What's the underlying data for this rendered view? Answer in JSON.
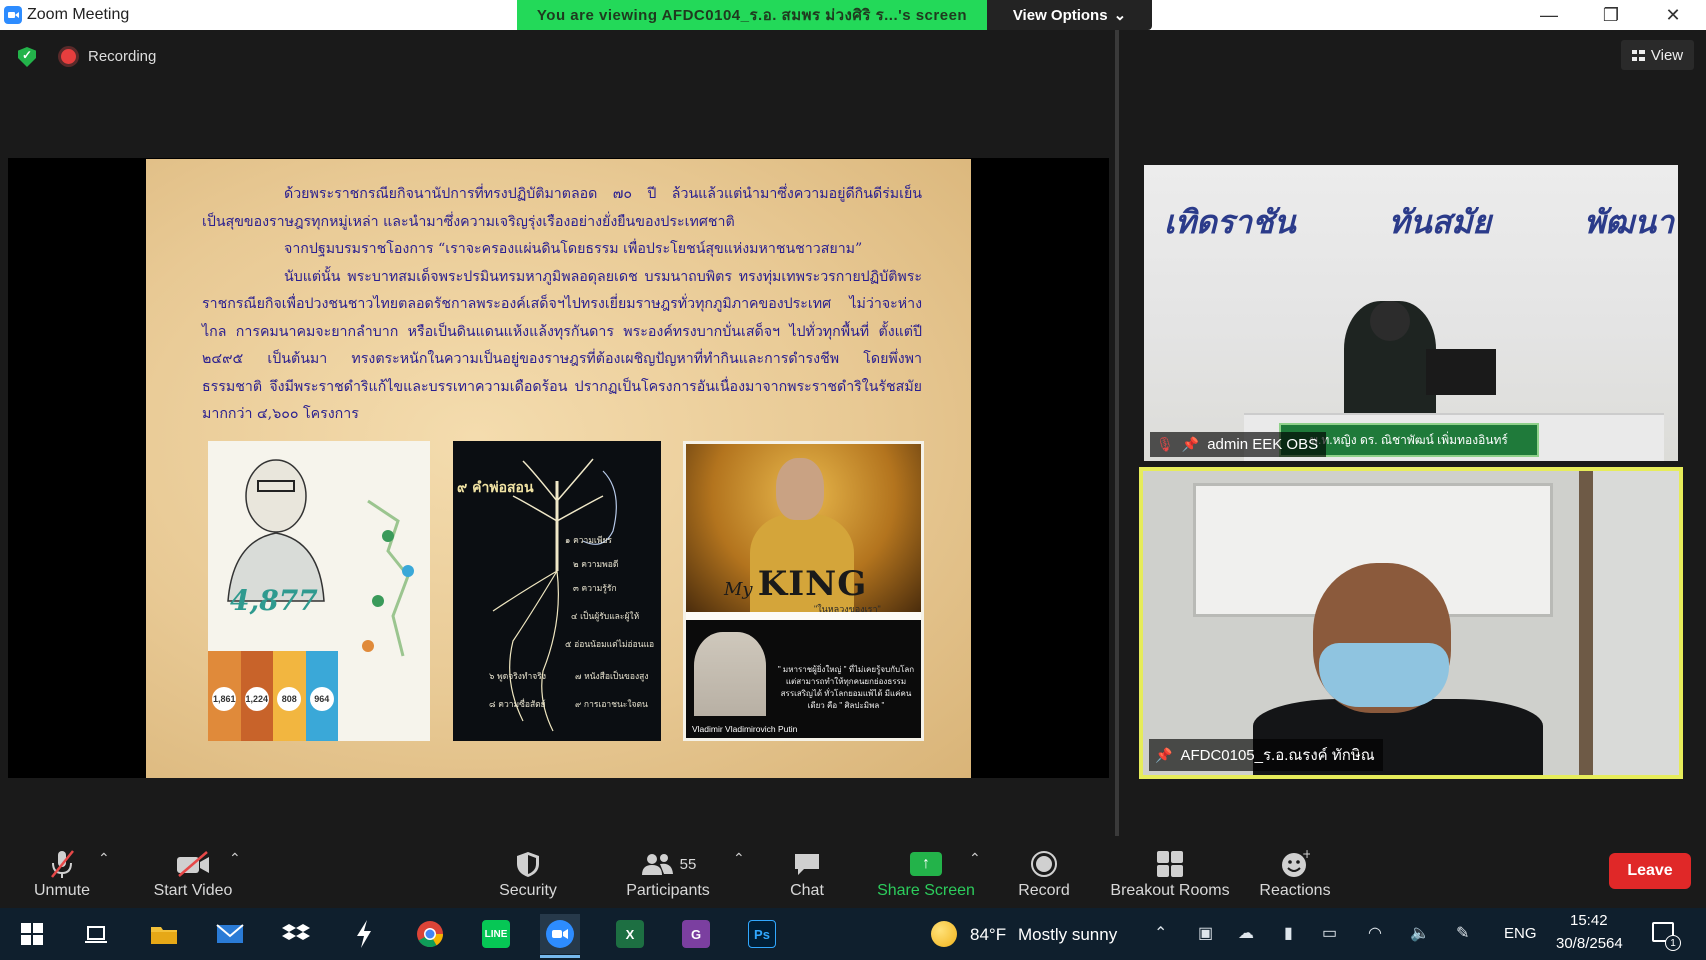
{
  "window": {
    "title": "Zoom Meeting",
    "share_banner": "You  are  viewing  AFDC0104_ร.อ. สมพร  ม่วงศิริ  ร...'s screen",
    "view_options": "View Options",
    "view_options_caret": "⌄",
    "minimize": "—",
    "restore": "❐",
    "close": "✕"
  },
  "meeting": {
    "recording_label": "Recording",
    "view_label": "View"
  },
  "slide": {
    "paragraphs": [
      "ด้วยพระราชกรณียกิจนานัปการที่ทรงปฏิบัติมาตลอด ๗๐ ปี ล้วนแล้วแต่นำมาซึ่งความอยู่ดีกินดีร่มเย็นเป็นสุขของราษฎรทุกหมู่เหล่า และนำมาซึ่งความเจริญรุ่งเรืองอย่างยั่งยืนของประเทศชาติ",
      "จากปฐมบรมราชโองการ “เราจะครองแผ่นดินโดยธรรม เพื่อประโยชน์สุขแห่งมหาชนชาวสยาม”",
      "นับแต่นั้น พระบาทสมเด็จพระปรมินทรมหาภูมิพลอดุลยเดช บรมนาถบพิตร ทรงทุ่มเทพระวรกายปฏิบัติพระราชกรณียกิจเพื่อปวงชนชาวไทยตลอดรัชกาลพระองค์เสด็จฯไปทรงเยี่ยมราษฎรทั่วทุกภูมิภาคของประเทศ ไม่ว่าจะห่างไกล การคมนาคมจะยากลำบาก หรือเป็นดินแดนแห้งแล้งทุรกันดาร พระองค์ทรงบากบั่นเสด็จฯ ไปทั่วทุกพื้นที่ ตั้งแต่ปี ๒๔๙๕ เป็นต้นมา ทรงตระหนักในความเป็นอยู่ของราษฎรที่ต้องเผชิญปัญหาที่ทำกินและการดำรงชีพ โดยพึ่งพาธรรมชาติ จึงมีพระราชดำริแก้ไขและบรรเทาความเดือดร้อน ปรากฏเป็นโครงการอันเนื่องมาจากพระราชดำริในรัชสมัยมากกว่า ๔,๖๐๐ โครงการ"
    ],
    "image1": {
      "big_number": "4,877",
      "bar_values": [
        "1,861",
        "1,224",
        "808",
        "964"
      ],
      "bar_colors": [
        "#e08a3a",
        "#c8632a",
        "#f2b640",
        "#3aa8d8"
      ]
    },
    "image2": {
      "title": "๙ คำพ่อสอน",
      "items": [
        "๑ ความเพียร",
        "๒ ความพอดี",
        "๓ ความรู้รัก",
        "๔ เป็นผู้รับและผู้ให้",
        "๕ อ่อนน้อมแต่ไม่อ่อนแอ",
        "๖ พูดจริงทำจริง",
        "๗ หนังสือเป็นของสูง",
        "๘ ความซื่อสัตย์",
        "๙ การเอาชนะใจตน"
      ]
    },
    "image3": {
      "my": "My",
      "king": "KING",
      "subtitle": "\"ในหลวงของเรา\"",
      "person_name": "Vladimir Vladimirovich Putin",
      "quote": "\" มหาราชผู้ยิ่งใหญ่ \" ที่ไม่เคยรู้จบกับโลก แต่สามารถทำให้ทุกคนยกย่องธรรมสรรเสริญได้ ทั่วโลกยอมแพ้ได้ มีแค่คนเดียว คือ \" ศิลปะมิพล \""
    }
  },
  "participants": [
    {
      "name": "admin EEK OBS",
      "banner_words": [
        "เทิดราชัน",
        "ทันสมัย",
        "พัฒนา"
      ],
      "nameplate": "พ.ท.หญิง ดร. ณิชาพัฒน์ เพิ่มทองอินทร์",
      "muted": true
    },
    {
      "name": "AFDC0105_ร.อ.ณรงค์ ทักษิณ",
      "muted": false
    }
  ],
  "toolbar": {
    "unmute": "Unmute",
    "start_video": "Start Video",
    "security": "Security",
    "participants": "Participants",
    "participants_count": "55",
    "chat": "Chat",
    "share_screen": "Share Screen",
    "record": "Record",
    "breakout_rooms": "Breakout Rooms",
    "reactions": "Reactions",
    "leave": "Leave",
    "caret": "⌃"
  },
  "taskbar": {
    "weather_temp": "84°F",
    "weather_desc": "Mostly sunny",
    "language": "ENG",
    "time": "15:42",
    "date": "30/8/2564",
    "notification_count": "1",
    "apps": [
      "start",
      "task-view",
      "file-explorer",
      "mail",
      "dropbox",
      "app-bolt",
      "chrome",
      "line",
      "zoom",
      "excel",
      "pdf",
      "photoshop"
    ]
  }
}
